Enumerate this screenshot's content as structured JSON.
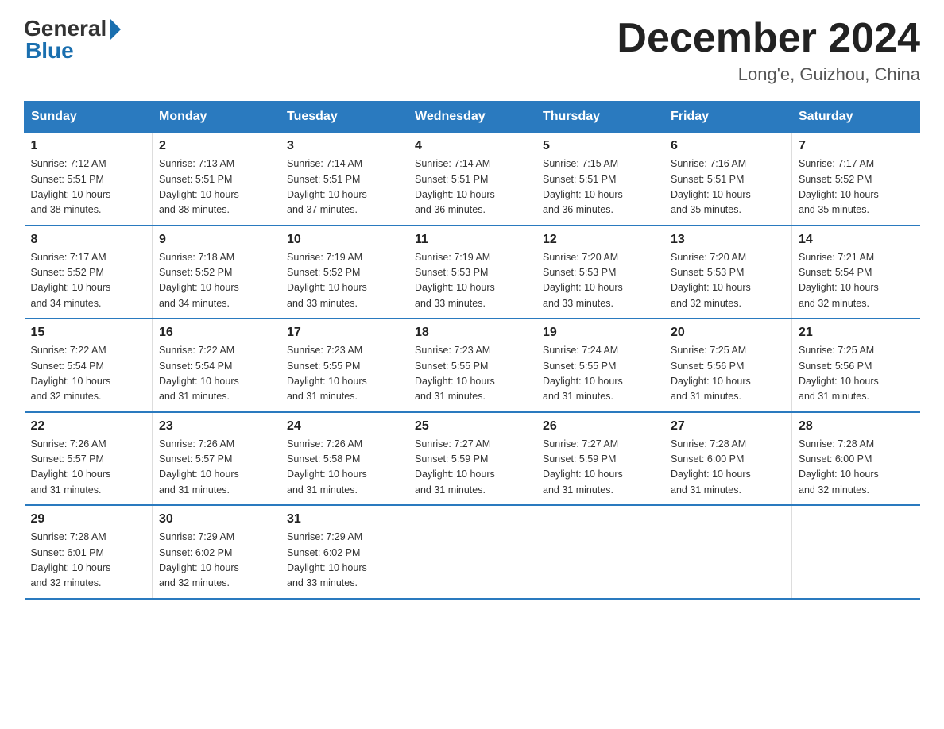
{
  "logo": {
    "general": "General",
    "blue": "Blue"
  },
  "title": "December 2024",
  "location": "Long'e, Guizhou, China",
  "days_of_week": [
    "Sunday",
    "Monday",
    "Tuesday",
    "Wednesday",
    "Thursday",
    "Friday",
    "Saturday"
  ],
  "weeks": [
    [
      {
        "day": "1",
        "info": "Sunrise: 7:12 AM\nSunset: 5:51 PM\nDaylight: 10 hours\nand 38 minutes."
      },
      {
        "day": "2",
        "info": "Sunrise: 7:13 AM\nSunset: 5:51 PM\nDaylight: 10 hours\nand 38 minutes."
      },
      {
        "day": "3",
        "info": "Sunrise: 7:14 AM\nSunset: 5:51 PM\nDaylight: 10 hours\nand 37 minutes."
      },
      {
        "day": "4",
        "info": "Sunrise: 7:14 AM\nSunset: 5:51 PM\nDaylight: 10 hours\nand 36 minutes."
      },
      {
        "day": "5",
        "info": "Sunrise: 7:15 AM\nSunset: 5:51 PM\nDaylight: 10 hours\nand 36 minutes."
      },
      {
        "day": "6",
        "info": "Sunrise: 7:16 AM\nSunset: 5:51 PM\nDaylight: 10 hours\nand 35 minutes."
      },
      {
        "day": "7",
        "info": "Sunrise: 7:17 AM\nSunset: 5:52 PM\nDaylight: 10 hours\nand 35 minutes."
      }
    ],
    [
      {
        "day": "8",
        "info": "Sunrise: 7:17 AM\nSunset: 5:52 PM\nDaylight: 10 hours\nand 34 minutes."
      },
      {
        "day": "9",
        "info": "Sunrise: 7:18 AM\nSunset: 5:52 PM\nDaylight: 10 hours\nand 34 minutes."
      },
      {
        "day": "10",
        "info": "Sunrise: 7:19 AM\nSunset: 5:52 PM\nDaylight: 10 hours\nand 33 minutes."
      },
      {
        "day": "11",
        "info": "Sunrise: 7:19 AM\nSunset: 5:53 PM\nDaylight: 10 hours\nand 33 minutes."
      },
      {
        "day": "12",
        "info": "Sunrise: 7:20 AM\nSunset: 5:53 PM\nDaylight: 10 hours\nand 33 minutes."
      },
      {
        "day": "13",
        "info": "Sunrise: 7:20 AM\nSunset: 5:53 PM\nDaylight: 10 hours\nand 32 minutes."
      },
      {
        "day": "14",
        "info": "Sunrise: 7:21 AM\nSunset: 5:54 PM\nDaylight: 10 hours\nand 32 minutes."
      }
    ],
    [
      {
        "day": "15",
        "info": "Sunrise: 7:22 AM\nSunset: 5:54 PM\nDaylight: 10 hours\nand 32 minutes."
      },
      {
        "day": "16",
        "info": "Sunrise: 7:22 AM\nSunset: 5:54 PM\nDaylight: 10 hours\nand 31 minutes."
      },
      {
        "day": "17",
        "info": "Sunrise: 7:23 AM\nSunset: 5:55 PM\nDaylight: 10 hours\nand 31 minutes."
      },
      {
        "day": "18",
        "info": "Sunrise: 7:23 AM\nSunset: 5:55 PM\nDaylight: 10 hours\nand 31 minutes."
      },
      {
        "day": "19",
        "info": "Sunrise: 7:24 AM\nSunset: 5:55 PM\nDaylight: 10 hours\nand 31 minutes."
      },
      {
        "day": "20",
        "info": "Sunrise: 7:25 AM\nSunset: 5:56 PM\nDaylight: 10 hours\nand 31 minutes."
      },
      {
        "day": "21",
        "info": "Sunrise: 7:25 AM\nSunset: 5:56 PM\nDaylight: 10 hours\nand 31 minutes."
      }
    ],
    [
      {
        "day": "22",
        "info": "Sunrise: 7:26 AM\nSunset: 5:57 PM\nDaylight: 10 hours\nand 31 minutes."
      },
      {
        "day": "23",
        "info": "Sunrise: 7:26 AM\nSunset: 5:57 PM\nDaylight: 10 hours\nand 31 minutes."
      },
      {
        "day": "24",
        "info": "Sunrise: 7:26 AM\nSunset: 5:58 PM\nDaylight: 10 hours\nand 31 minutes."
      },
      {
        "day": "25",
        "info": "Sunrise: 7:27 AM\nSunset: 5:59 PM\nDaylight: 10 hours\nand 31 minutes."
      },
      {
        "day": "26",
        "info": "Sunrise: 7:27 AM\nSunset: 5:59 PM\nDaylight: 10 hours\nand 31 minutes."
      },
      {
        "day": "27",
        "info": "Sunrise: 7:28 AM\nSunset: 6:00 PM\nDaylight: 10 hours\nand 31 minutes."
      },
      {
        "day": "28",
        "info": "Sunrise: 7:28 AM\nSunset: 6:00 PM\nDaylight: 10 hours\nand 32 minutes."
      }
    ],
    [
      {
        "day": "29",
        "info": "Sunrise: 7:28 AM\nSunset: 6:01 PM\nDaylight: 10 hours\nand 32 minutes."
      },
      {
        "day": "30",
        "info": "Sunrise: 7:29 AM\nSunset: 6:02 PM\nDaylight: 10 hours\nand 32 minutes."
      },
      {
        "day": "31",
        "info": "Sunrise: 7:29 AM\nSunset: 6:02 PM\nDaylight: 10 hours\nand 33 minutes."
      },
      null,
      null,
      null,
      null
    ]
  ]
}
